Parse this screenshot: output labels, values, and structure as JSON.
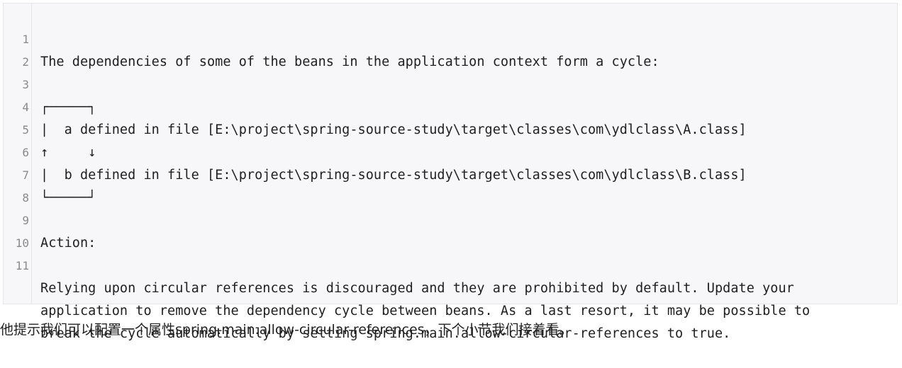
{
  "code_block": {
    "lines": [
      {
        "num": "1",
        "text": "The dependencies of some of the beans in the application context form a cycle:"
      },
      {
        "num": "2",
        "text": ""
      },
      {
        "num": "3",
        "text": "┌─────┐"
      },
      {
        "num": "4",
        "text": "|  a defined in file [E:\\project\\spring-source-study\\target\\classes\\com\\ydlclass\\A.class]"
      },
      {
        "num": "5",
        "text": "↑     ↓"
      },
      {
        "num": "6",
        "text": "|  b defined in file [E:\\project\\spring-source-study\\target\\classes\\com\\ydlclass\\B.class]"
      },
      {
        "num": "7",
        "text": "└─────┘"
      },
      {
        "num": "8",
        "text": ""
      },
      {
        "num": "9",
        "text": "Action:"
      },
      {
        "num": "10",
        "text": ""
      },
      {
        "num": "11",
        "text": "Relying upon circular references is discouraged and they are prohibited by default. Update your"
      },
      {
        "num": "",
        "text": "application to remove the dependency cycle between beans. As a last resort, it may be possible to"
      },
      {
        "num": "",
        "text": "break the cycle automatically by setting spring.main.allow-circular-references to true."
      }
    ]
  },
  "paragraph": {
    "text": "他提示我们可以配置一个属性spring.main.allow-circular-references，下个小节我们接着看。"
  }
}
